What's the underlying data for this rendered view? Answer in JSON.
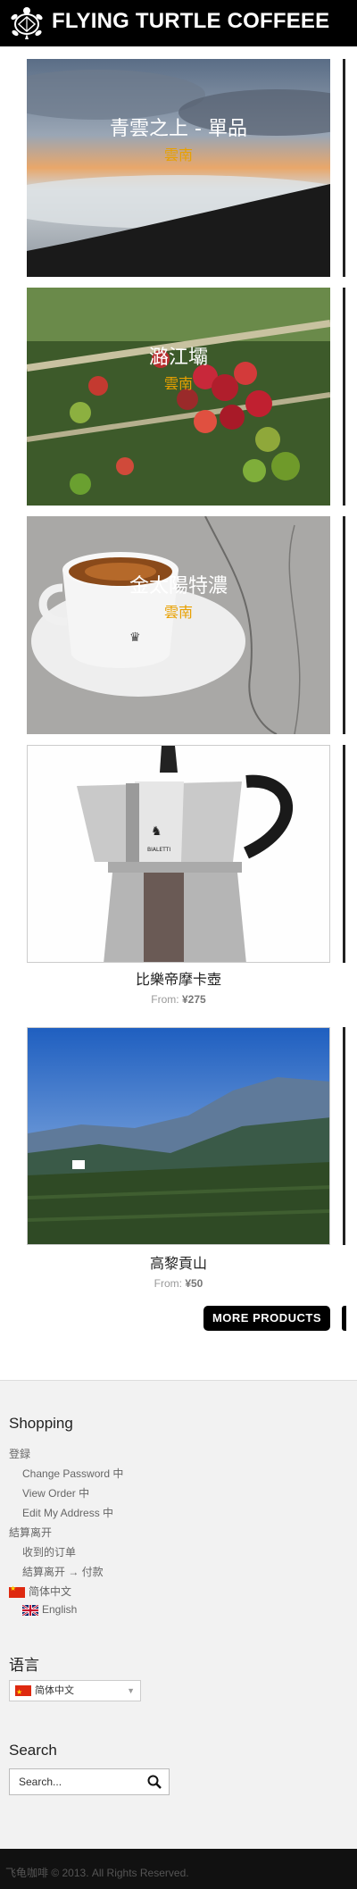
{
  "header": {
    "site_title": "FLYING TURTLE COFFEEE",
    "logo_icon": "turtle-logo-icon",
    "bg_color": "#000000"
  },
  "products": [
    {
      "title": "青雲之上 - 單品",
      "subtitle": "雲南"
    },
    {
      "title": "潞江壩",
      "subtitle": "雲南"
    },
    {
      "title": "金太陽特濃",
      "subtitle": "雲南"
    },
    {
      "name": "比樂帝摩卡壺",
      "price_prefix": "From:",
      "price": "¥275"
    },
    {
      "name": "高黎貢山",
      "price_prefix": "From:",
      "price": "¥50"
    }
  ],
  "more_button": "MORE PRODUCTS",
  "shopping": {
    "title": "Shopping",
    "links": [
      "登録",
      "Change Password 中",
      "View Order 中",
      "Edit My Address 中",
      "結算离开",
      "收到的订单",
      "結算离开 → 付款",
      "简体中文",
      "English"
    ]
  },
  "language": {
    "title": "语言",
    "selected": "简体中文"
  },
  "search": {
    "title": "Search",
    "placeholder": "Search..."
  },
  "footer": {
    "copyright": "飞龟咖啡 © 2013. All Rights Reserved."
  },
  "colors": {
    "accent_subtitle": "#e8a000",
    "footer_bg": "#f2f2f2"
  }
}
